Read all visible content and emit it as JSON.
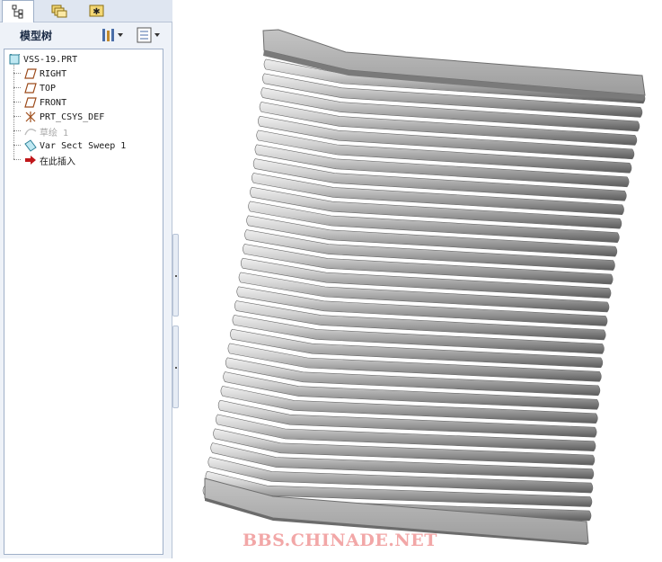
{
  "tabs": [
    {
      "icon": "model-tree-icon",
      "active": true
    },
    {
      "icon": "folder-browser-icon",
      "active": false
    },
    {
      "icon": "favorites-icon",
      "active": false
    }
  ],
  "model_tree": {
    "title": "模型树",
    "settings_icon": "tree-settings-icon",
    "show_icon": "tree-columns-icon",
    "items": [
      {
        "label": "VSS-19.PRT",
        "icon": "part-icon",
        "state": "normal"
      },
      {
        "label": "RIGHT",
        "icon": "datum-plane-icon",
        "state": "normal"
      },
      {
        "label": "TOP",
        "icon": "datum-plane-icon",
        "state": "normal"
      },
      {
        "label": "FRONT",
        "icon": "datum-plane-icon",
        "state": "normal"
      },
      {
        "label": "PRT_CSYS_DEF",
        "icon": "coordinate-system-icon",
        "state": "normal"
      },
      {
        "label": "草绘 1",
        "icon": "sketch-icon",
        "state": "suppressed"
      },
      {
        "label": "Var Sect Sweep 1",
        "icon": "sweep-icon",
        "state": "normal"
      },
      {
        "label": "在此插入",
        "icon": "insert-here-icon",
        "state": "normal"
      }
    ]
  },
  "model": {
    "name": "corrugated-variable-section-sweep",
    "color_light": "#d9d9d9",
    "color_mid": "#a9a9a9",
    "color_dark": "#5f5f5f",
    "rib_count": 31
  },
  "watermark": "BBS.CHINADE.NET"
}
